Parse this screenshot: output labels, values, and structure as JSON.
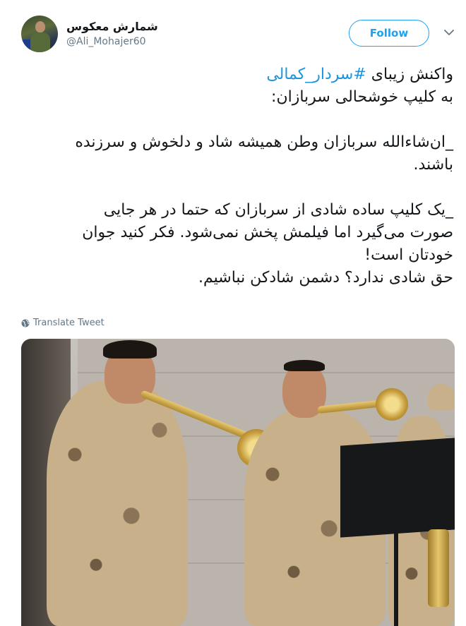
{
  "user": {
    "display_name": "شمارش معکوس",
    "handle": "@Ali_Mohajer60"
  },
  "follow_label": "Follow",
  "tweet": {
    "line1_prefix": "واکنش زیبای ",
    "hashtag": "#سردار_کمالی",
    "line2": "به کلیپ خوشحالی سربازان:",
    "para2_line1": "_ان‌شاءالله سربازان وطن همیشه شاد و دلخوش و سرزنده",
    "para2_line2": "باشند.",
    "para3_line1": "_یک کلیپ ساده شادی از سربازان که حتما در هر جایی",
    "para3_line2": "صورت می‌گیرد اما فیلمش پخش نمی‌شود. فکر کنید جوان",
    "para3_line3": "خودتان است!",
    "para3_line4": "حق شادی ندارد؟ دشمن شادکن نباشیم."
  },
  "translate_label": "Translate Tweet",
  "icons": {
    "chevron": "chevron-down-icon",
    "globe": "globe-icon"
  },
  "colors": {
    "accent": "#1da1f2",
    "hashtag": "#1b95e0",
    "secondary_text": "#657786"
  }
}
